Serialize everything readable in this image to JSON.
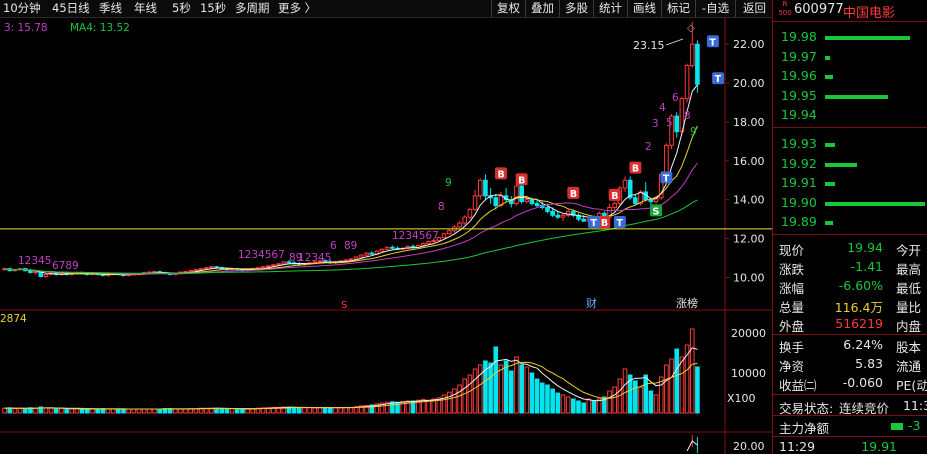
{
  "toolbar": {
    "periods": [
      "10分钟",
      "45日线",
      "季线",
      "年线",
      "5秒",
      "15秒",
      "多周期",
      "更多 〉"
    ],
    "tools": [
      "复权",
      "叠加",
      "多股",
      "统计",
      "画线",
      "标记",
      "-自选",
      "返回"
    ]
  },
  "ma_legend": {
    "ma3": "3: 15.78",
    "ma4": "MA4: 13.52"
  },
  "price_axis_ticks": [
    "22.00",
    "20.00",
    "18.00",
    "16.00",
    "14.00",
    "12.00",
    "10.00"
  ],
  "volume_axis_ticks": [
    "20000",
    "10000"
  ],
  "volume_multiplier": "X100",
  "volume_label": "2874",
  "bottom_axis_tick": "20.00",
  "high_callout": "23.15",
  "event_labels": {
    "earnings": "财",
    "limit_list": "涨榜",
    "split": "S"
  },
  "signals": {
    "buy": "B",
    "top": "T",
    "sell": "S"
  },
  "counts": {
    "seq1": "12345",
    "seq1b": "6789",
    "seq2": "1234567",
    "seq2b": "89",
    "seq3": "12345",
    "seq4": "6",
    "seq4b": "89",
    "seq5": "1234567",
    "seq5b": "8",
    "seq5c": "9",
    "seq6": [
      "2",
      "3",
      "4",
      "5",
      "6",
      "8",
      "9"
    ]
  },
  "colors": {
    "up": "#ff3a3a",
    "down": "#00e5ee",
    "ma_white": "#f0f0f0",
    "ma_yellow": "#e8d030",
    "ma_magenta": "#c040c0",
    "ma_green": "#18c83a",
    "baseline": "#e8e830"
  },
  "quote": {
    "badge_top": "R",
    "badge_num": "500",
    "code": "600977",
    "name": "中国电影",
    "bids": [
      {
        "price": "19.98",
        "vol_pct": 0.85
      },
      {
        "price": "19.97",
        "vol_pct": 0.05
      },
      {
        "price": "19.96",
        "vol_pct": 0.08
      },
      {
        "price": "19.95",
        "vol_pct": 0.63
      },
      {
        "price": "19.94",
        "vol_pct": 0.0
      }
    ],
    "asks": [
      {
        "price": "19.93",
        "vol_pct": 0.1
      },
      {
        "price": "19.92",
        "vol_pct": 0.32
      },
      {
        "price": "19.91",
        "vol_pct": 0.1
      },
      {
        "price": "19.90",
        "vol_pct": 1.0
      },
      {
        "price": "19.89",
        "vol_pct": 0.08
      }
    ],
    "stats": {
      "xianjia_label": "现价",
      "xianjia": "19.94",
      "jinkai_label": "今开",
      "zhangdie_label": "涨跌",
      "zhangdie": "-1.41",
      "zuigao_label": "最高",
      "zhangfu_label": "涨幅",
      "zhangfu": "-6.60%",
      "zuidi_label": "最低",
      "zongliang_label": "总量",
      "zongliang": "116.4万",
      "liangbi_label": "量比",
      "waipan_label": "外盘",
      "waipan": "516219",
      "neipan_label": "内盘",
      "huanshou_label": "换手",
      "huanshou": "6.24%",
      "guben_label": "股本",
      "jingzi_label": "净资",
      "jingzi": "5.83",
      "liutong_label": "流通",
      "shouyi_label": "收益㈡",
      "shouyi": "-0.060",
      "pe_label": "PE(动"
    },
    "trade_status_label": "交易状态:",
    "trade_status": "连续竞价",
    "trade_time_partial": "11:3",
    "main_flow_label": "主力净额",
    "main_flow_value": "-3",
    "tick_time": "11:29",
    "tick_price": "19.91"
  },
  "chart_data": {
    "type": "candlestick",
    "price_range": [
      9.2,
      23.4
    ],
    "volume_range": [
      0,
      24000
    ],
    "baseline": 12.5,
    "candles": [
      [
        10.45,
        10.5,
        10.35,
        10.45,
        1200
      ],
      [
        10.45,
        10.5,
        10.3,
        10.35,
        1300
      ],
      [
        10.35,
        10.45,
        10.3,
        10.4,
        1100
      ],
      [
        10.4,
        10.5,
        10.35,
        10.45,
        1200
      ],
      [
        10.45,
        10.5,
        10.3,
        10.35,
        1100
      ],
      [
        10.35,
        10.45,
        10.2,
        10.25,
        1300
      ],
      [
        10.25,
        10.35,
        10.15,
        10.3,
        1200
      ],
      [
        10.3,
        10.35,
        10.0,
        10.05,
        1500
      ],
      [
        10.05,
        10.2,
        10.0,
        10.15,
        1300
      ],
      [
        10.15,
        10.3,
        10.1,
        10.25,
        1200
      ],
      [
        10.25,
        10.3,
        10.1,
        10.15,
        1100
      ],
      [
        10.15,
        10.25,
        10.1,
        10.2,
        1100
      ],
      [
        10.2,
        10.3,
        10.1,
        10.15,
        1000
      ],
      [
        10.15,
        10.25,
        10.1,
        10.2,
        1000
      ],
      [
        10.2,
        10.3,
        10.15,
        10.25,
        1100
      ],
      [
        10.25,
        10.3,
        10.15,
        10.2,
        1000
      ],
      [
        10.2,
        10.25,
        10.1,
        10.15,
        1000
      ],
      [
        10.15,
        10.25,
        10.1,
        10.2,
        1000
      ],
      [
        10.2,
        10.25,
        10.1,
        10.15,
        1000
      ],
      [
        10.15,
        10.2,
        10.05,
        10.1,
        1100
      ],
      [
        10.1,
        10.2,
        10.05,
        10.15,
        1000
      ],
      [
        10.15,
        10.25,
        10.1,
        10.2,
        1000
      ],
      [
        10.2,
        10.25,
        10.1,
        10.15,
        1000
      ],
      [
        10.15,
        10.2,
        10.05,
        10.1,
        1000
      ],
      [
        10.1,
        10.2,
        10.05,
        10.15,
        1000
      ],
      [
        10.15,
        10.2,
        10.1,
        10.18,
        1000
      ],
      [
        10.18,
        10.25,
        10.1,
        10.2,
        1000
      ],
      [
        10.2,
        10.3,
        10.15,
        10.25,
        1000
      ],
      [
        10.25,
        10.3,
        10.2,
        10.28,
        1000
      ],
      [
        10.28,
        10.35,
        10.2,
        10.3,
        1000
      ],
      [
        10.3,
        10.35,
        10.2,
        10.25,
        1000
      ],
      [
        10.25,
        10.3,
        10.15,
        10.2,
        1100
      ],
      [
        10.2,
        10.25,
        10.1,
        10.15,
        1100
      ],
      [
        10.15,
        10.25,
        10.1,
        10.2,
        1000
      ],
      [
        10.2,
        10.3,
        10.15,
        10.28,
        1000
      ],
      [
        10.28,
        10.35,
        10.2,
        10.3,
        1000
      ],
      [
        10.3,
        10.4,
        10.25,
        10.35,
        1100
      ],
      [
        10.35,
        10.45,
        10.3,
        10.4,
        1100
      ],
      [
        10.4,
        10.5,
        10.35,
        10.45,
        1200
      ],
      [
        10.45,
        10.55,
        10.4,
        10.5,
        1200
      ],
      [
        10.5,
        10.6,
        10.45,
        10.55,
        1200
      ],
      [
        10.55,
        10.6,
        10.45,
        10.5,
        1200
      ],
      [
        10.5,
        10.55,
        10.4,
        10.45,
        1100
      ],
      [
        10.45,
        10.5,
        10.35,
        10.4,
        1100
      ],
      [
        10.4,
        10.5,
        10.35,
        10.45,
        1100
      ],
      [
        10.45,
        10.5,
        10.35,
        10.4,
        1000
      ],
      [
        10.4,
        10.45,
        10.3,
        10.35,
        1000
      ],
      [
        10.35,
        10.45,
        10.3,
        10.4,
        1000
      ],
      [
        10.4,
        10.5,
        10.35,
        10.45,
        1100
      ],
      [
        10.45,
        10.55,
        10.4,
        10.5,
        1200
      ],
      [
        10.5,
        10.6,
        10.45,
        10.55,
        1300
      ],
      [
        10.55,
        10.65,
        10.5,
        10.6,
        1300
      ],
      [
        10.6,
        10.7,
        10.55,
        10.65,
        1400
      ],
      [
        10.65,
        10.75,
        10.6,
        10.7,
        1400
      ],
      [
        10.7,
        10.85,
        10.65,
        10.8,
        1500
      ],
      [
        10.8,
        10.9,
        10.7,
        10.75,
        1500
      ],
      [
        10.75,
        10.85,
        10.65,
        10.7,
        1400
      ],
      [
        10.7,
        10.8,
        10.6,
        10.65,
        1300
      ],
      [
        10.65,
        10.75,
        10.6,
        10.7,
        1300
      ],
      [
        10.7,
        10.8,
        10.65,
        10.75,
        1300
      ],
      [
        10.75,
        10.85,
        10.7,
        10.8,
        1300
      ],
      [
        10.8,
        10.9,
        10.75,
        10.85,
        1400
      ],
      [
        10.85,
        10.95,
        10.75,
        10.8,
        1400
      ],
      [
        10.8,
        10.9,
        10.7,
        10.75,
        1300
      ],
      [
        10.75,
        10.85,
        10.7,
        10.8,
        1300
      ],
      [
        10.8,
        10.9,
        10.75,
        10.85,
        1300
      ],
      [
        10.85,
        10.95,
        10.8,
        10.9,
        1400
      ],
      [
        10.9,
        11.0,
        10.85,
        10.95,
        1400
      ],
      [
        10.95,
        11.1,
        10.9,
        11.05,
        1600
      ],
      [
        11.05,
        11.2,
        11.0,
        11.15,
        1800
      ],
      [
        11.15,
        11.3,
        11.1,
        11.25,
        1900
      ],
      [
        11.25,
        11.35,
        11.15,
        11.2,
        2000
      ],
      [
        11.2,
        11.4,
        11.15,
        11.35,
        2300
      ],
      [
        11.35,
        11.5,
        11.3,
        11.45,
        2500
      ],
      [
        11.45,
        11.6,
        11.4,
        11.55,
        2700
      ],
      [
        11.55,
        11.65,
        11.45,
        11.5,
        2800
      ],
      [
        11.5,
        11.6,
        11.4,
        11.45,
        2700
      ],
      [
        11.45,
        11.55,
        11.4,
        11.5,
        2900
      ],
      [
        11.5,
        11.65,
        11.45,
        11.6,
        3000
      ],
      [
        11.6,
        11.7,
        11.5,
        11.55,
        3000
      ],
      [
        11.55,
        11.7,
        11.5,
        11.65,
        3200
      ],
      [
        11.65,
        11.8,
        11.6,
        11.75,
        3400
      ],
      [
        11.75,
        11.9,
        11.7,
        11.85,
        3200
      ],
      [
        11.85,
        12.0,
        11.8,
        11.9,
        3500
      ],
      [
        11.9,
        12.1,
        11.85,
        12.05,
        3800
      ],
      [
        12.05,
        12.3,
        12.0,
        12.25,
        4500
      ],
      [
        12.25,
        12.5,
        12.2,
        12.4,
        5200
      ],
      [
        12.4,
        12.7,
        12.3,
        12.6,
        6000
      ],
      [
        12.6,
        12.9,
        12.55,
        12.8,
        7000
      ],
      [
        12.8,
        13.2,
        12.7,
        13.1,
        8500
      ],
      [
        13.1,
        13.6,
        13.0,
        13.5,
        9500
      ],
      [
        13.5,
        14.5,
        13.4,
        14.2,
        11000
      ],
      [
        14.2,
        15.1,
        14.0,
        15.0,
        12000
      ],
      [
        15.0,
        15.3,
        14.0,
        14.2,
        13000
      ],
      [
        14.2,
        14.6,
        13.8,
        14.1,
        12500
      ],
      [
        14.1,
        14.3,
        13.5,
        13.7,
        16500
      ],
      [
        13.7,
        14.4,
        13.6,
        14.2,
        12000
      ],
      [
        14.2,
        14.6,
        13.9,
        14.0,
        13000
      ],
      [
        14.0,
        14.2,
        13.6,
        13.8,
        10500
      ],
      [
        13.8,
        14.9,
        13.7,
        14.7,
        14000
      ],
      [
        14.7,
        14.8,
        13.8,
        13.9,
        12000
      ],
      [
        13.9,
        14.2,
        13.8,
        14.0,
        11500
      ],
      [
        14.0,
        14.1,
        13.7,
        13.8,
        10000
      ],
      [
        13.8,
        14.0,
        13.6,
        13.7,
        8500
      ],
      [
        13.7,
        13.9,
        13.5,
        13.6,
        7500
      ],
      [
        13.6,
        13.8,
        13.3,
        13.4,
        7000
      ],
      [
        13.4,
        13.6,
        13.1,
        13.2,
        6000
      ],
      [
        13.2,
        13.4,
        13.0,
        13.1,
        5000
      ],
      [
        13.1,
        13.3,
        12.9,
        13.2,
        4500
      ],
      [
        13.2,
        13.5,
        13.1,
        13.4,
        4000
      ],
      [
        13.4,
        13.5,
        13.1,
        13.2,
        3500
      ],
      [
        13.2,
        13.3,
        12.9,
        13.0,
        3000
      ],
      [
        13.0,
        13.2,
        12.85,
        12.9,
        2500
      ],
      [
        12.9,
        13.1,
        12.8,
        13.0,
        3500
      ],
      [
        13.0,
        13.2,
        12.85,
        12.9,
        3000
      ],
      [
        12.9,
        13.4,
        12.85,
        13.3,
        3500
      ],
      [
        13.3,
        13.4,
        13.0,
        13.1,
        4000
      ],
      [
        13.1,
        13.8,
        13.0,
        13.6,
        5500
      ],
      [
        13.6,
        13.9,
        13.4,
        13.8,
        6500
      ],
      [
        13.8,
        14.7,
        13.7,
        14.6,
        8500
      ],
      [
        14.6,
        15.2,
        14.4,
        15.0,
        11000
      ],
      [
        15.0,
        15.2,
        14.0,
        14.1,
        9500
      ],
      [
        14.1,
        14.3,
        13.7,
        13.8,
        8000
      ],
      [
        13.8,
        14.5,
        13.7,
        14.4,
        6500
      ],
      [
        14.4,
        14.9,
        13.9,
        14.0,
        9500
      ],
      [
        14.0,
        14.1,
        13.7,
        13.9,
        5500
      ],
      [
        13.9,
        14.2,
        13.8,
        14.1,
        4500
      ],
      [
        14.1,
        15.4,
        14.0,
        15.3,
        9000
      ],
      [
        15.3,
        16.9,
        15.2,
        16.8,
        12000
      ],
      [
        16.8,
        18.4,
        16.6,
        18.3,
        13500
      ],
      [
        18.3,
        18.5,
        17.2,
        17.5,
        16000
      ],
      [
        17.5,
        19.3,
        17.3,
        19.2,
        14000
      ],
      [
        19.2,
        21.0,
        19.0,
        20.9,
        17000
      ],
      [
        20.9,
        23.15,
        20.8,
        22.0,
        21000
      ],
      [
        22.0,
        22.2,
        19.5,
        19.94,
        11500
      ]
    ]
  }
}
